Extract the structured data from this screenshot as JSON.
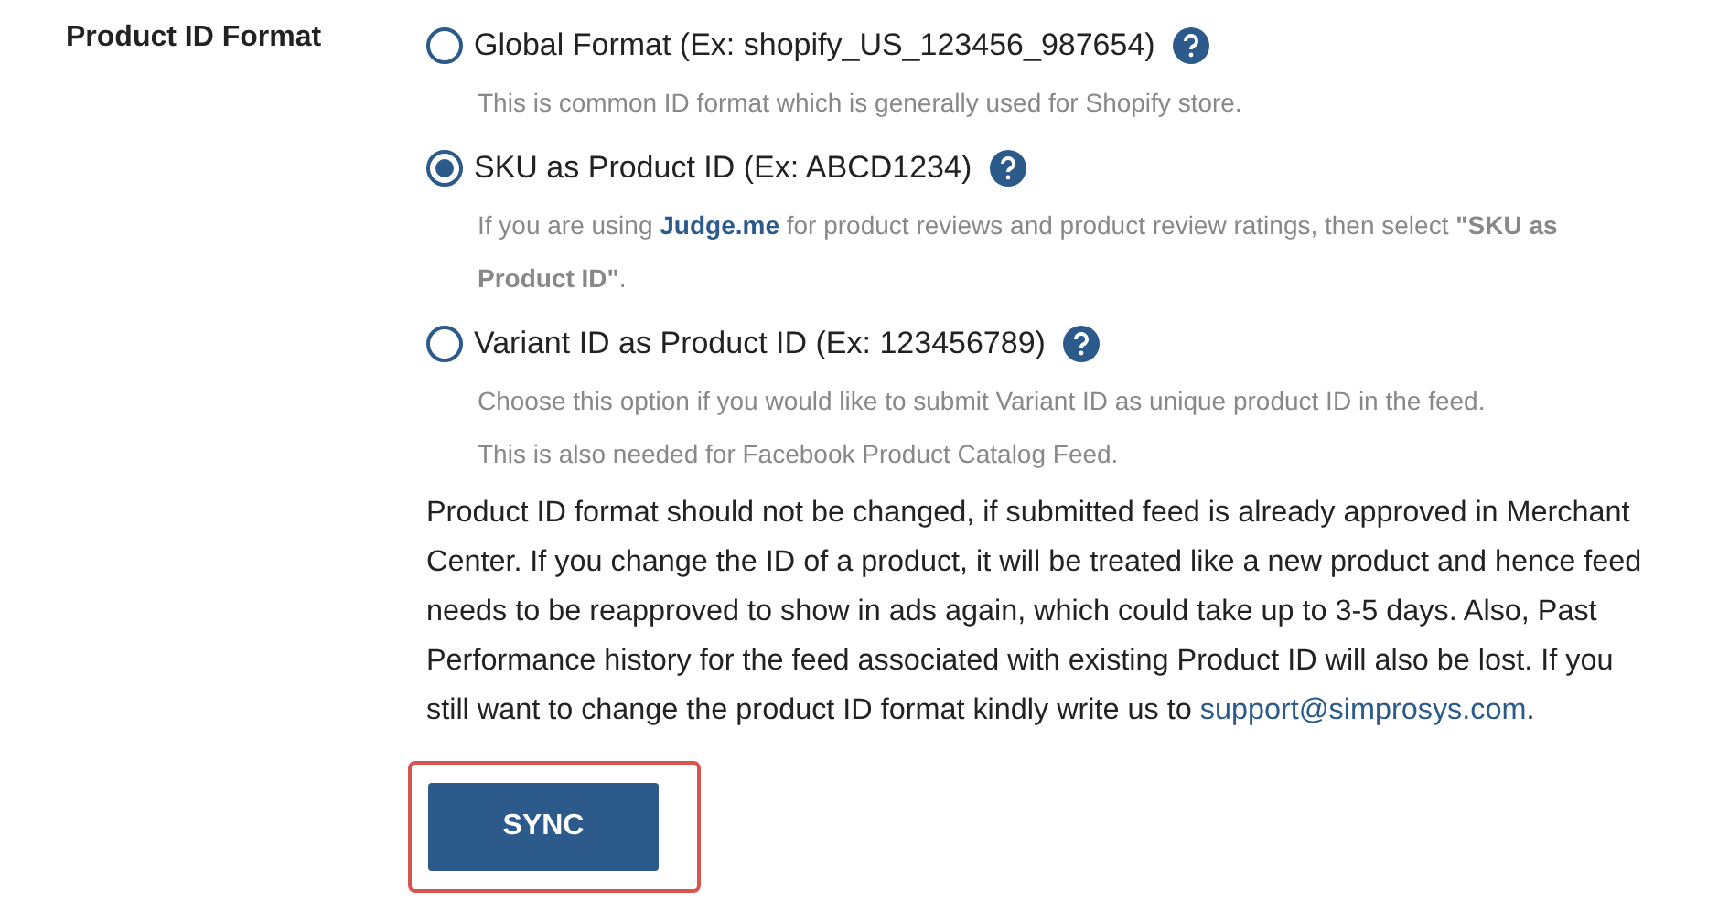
{
  "field_label": "Product ID Format",
  "options": [
    {
      "label": "Global Format (Ex: shopify_US_123456_987654)",
      "selected": false,
      "description": [
        {
          "text": "This is common ID format which is generally used for Shopify store."
        }
      ]
    },
    {
      "label": "SKU as Product ID (Ex: ABCD1234)",
      "selected": true,
      "description": [
        {
          "text": "If you are using ",
          "link": "Judge.me",
          "after": " for product reviews and product review ratings, then select **\"SKU as Product ID\"**."
        }
      ]
    },
    {
      "label": "Variant ID as Product ID (Ex: 123456789)",
      "selected": false,
      "description": [
        {
          "text": "Choose this option if you would like to submit Variant ID as unique product ID in the feed."
        },
        {
          "text": "This is also needed for Facebook Product Catalog Feed."
        }
      ]
    }
  ],
  "notice": {
    "text": "Product ID format should not be changed, if submitted feed is already approved in Merchant Center. If you change the ID of a product, it will be treated like a new product and hence feed needs to be reapproved to show in ads again, which could take up to 3-5 days. Also, Past Performance history for the feed associated with existing Product ID will also be lost. If you still want to change the product ID format kindly write us to ",
    "link": "support@simprosys.com",
    "after": "."
  },
  "sync_button": {
    "label": "SYNC",
    "highlighted": true
  }
}
